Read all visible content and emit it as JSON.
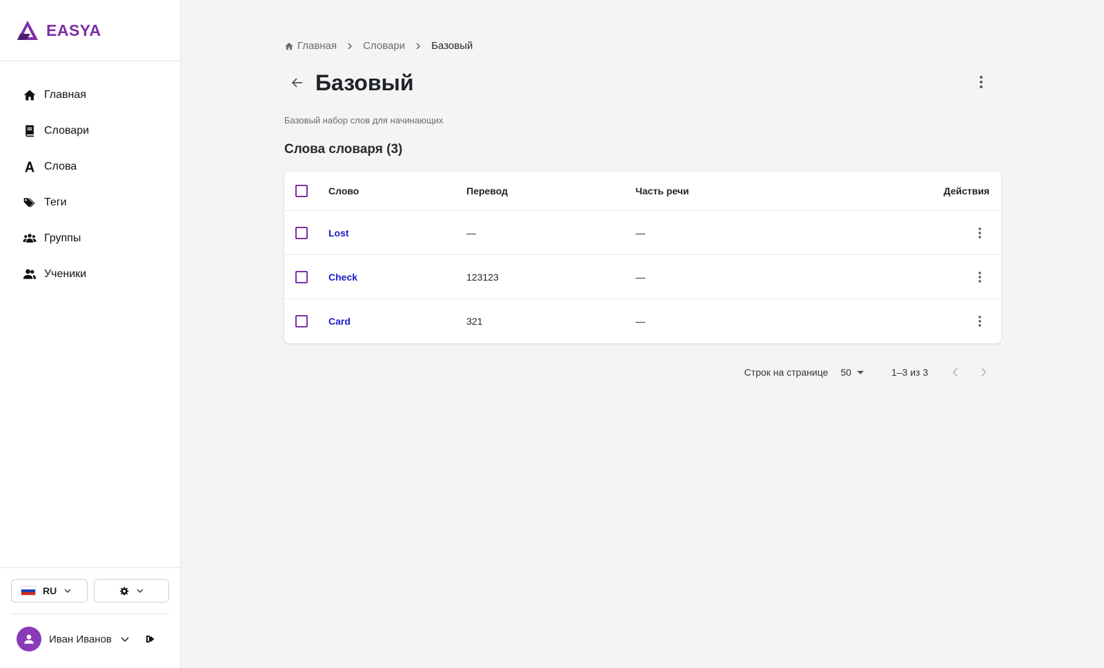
{
  "app": {
    "name": "EASYA",
    "brand_color": "#7b2fa6"
  },
  "sidebar": {
    "items": [
      {
        "label": "Главная",
        "icon": "home-icon"
      },
      {
        "label": "Словари",
        "icon": "book-icon"
      },
      {
        "label": "Слова",
        "icon": "letter-a-icon"
      },
      {
        "label": "Теги",
        "icon": "tags-icon"
      },
      {
        "label": "Группы",
        "icon": "group-icon"
      },
      {
        "label": "Ученики",
        "icon": "students-icon"
      }
    ],
    "language": "RU",
    "theme_icon": "gear-icon",
    "user": {
      "name": "Иван Иванов"
    }
  },
  "breadcrumb": {
    "home": "Главная",
    "dictionaries": "Словари",
    "current": "Базовый"
  },
  "page": {
    "title": "Базовый",
    "subtitle": "Базовый набор слов для начинающих",
    "section_title": "Слова словаря (3)"
  },
  "table": {
    "headers": {
      "word": "Слово",
      "translation": "Перевод",
      "part_of_speech": "Часть речи",
      "actions": "Действия"
    },
    "rows": [
      {
        "word": "Lost",
        "translation": "—",
        "part_of_speech": "—"
      },
      {
        "word": "Check",
        "translation": "123123",
        "part_of_speech": "—"
      },
      {
        "word": "Card",
        "translation": "321",
        "part_of_speech": "—"
      }
    ]
  },
  "pagination": {
    "rows_per_page_label": "Строк на странице",
    "rows_per_page": "50",
    "range": "1–3 из 3"
  }
}
